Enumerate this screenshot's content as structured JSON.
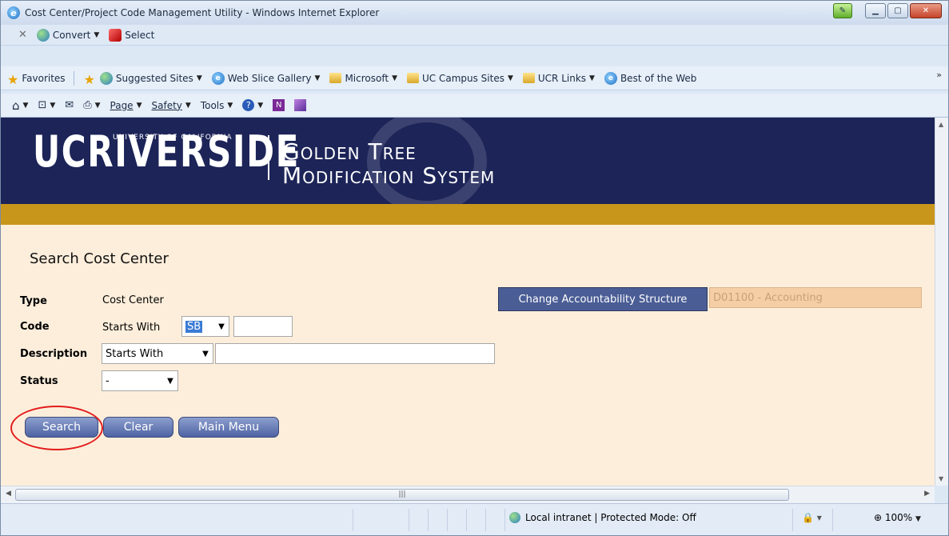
{
  "browser": {
    "title": "Cost Center/Project Code Management Utility - Windows Internet Explorer",
    "bar1": {
      "convert": "Convert",
      "select": "Select"
    },
    "favorites": {
      "label": "Favorites",
      "items": [
        "Suggested Sites",
        "Web Slice Gallery",
        "Microsoft",
        "UC Campus Sites",
        "UCR Links",
        "Best of the Web"
      ]
    },
    "command": {
      "page": "Page",
      "safety": "Safety",
      "tools": "Tools"
    },
    "status": {
      "zone": "Local intranet | Protected Mode: Off",
      "zoom": "100%"
    }
  },
  "banner": {
    "logo_main": "UCRIVERSIDE",
    "logo_sub": "UNIVERSITY OF CALIFORNIA",
    "app_line1": "Golden Tree",
    "app_line2": "Modification System"
  },
  "page": {
    "heading": "Search Cost Center",
    "type_label": "Type",
    "type_value": "Cost Center",
    "code_label": "Code",
    "code_mode": "Starts With",
    "code_prefix": "SB",
    "code_value": "",
    "desc_label": "Description",
    "desc_mode": "Starts With",
    "desc_value": "",
    "status_label": "Status",
    "status_value": "-",
    "change_btn": "Change Accountability Structure",
    "structure_value": "D01100 - Accounting",
    "buttons": {
      "search": "Search",
      "clear": "Clear",
      "main_menu": "Main Menu"
    }
  },
  "colors": {
    "banner": "#1c2458",
    "gold": "#c8961a",
    "page_bg": "#fdeedb",
    "highlight": "#e21d1d"
  }
}
